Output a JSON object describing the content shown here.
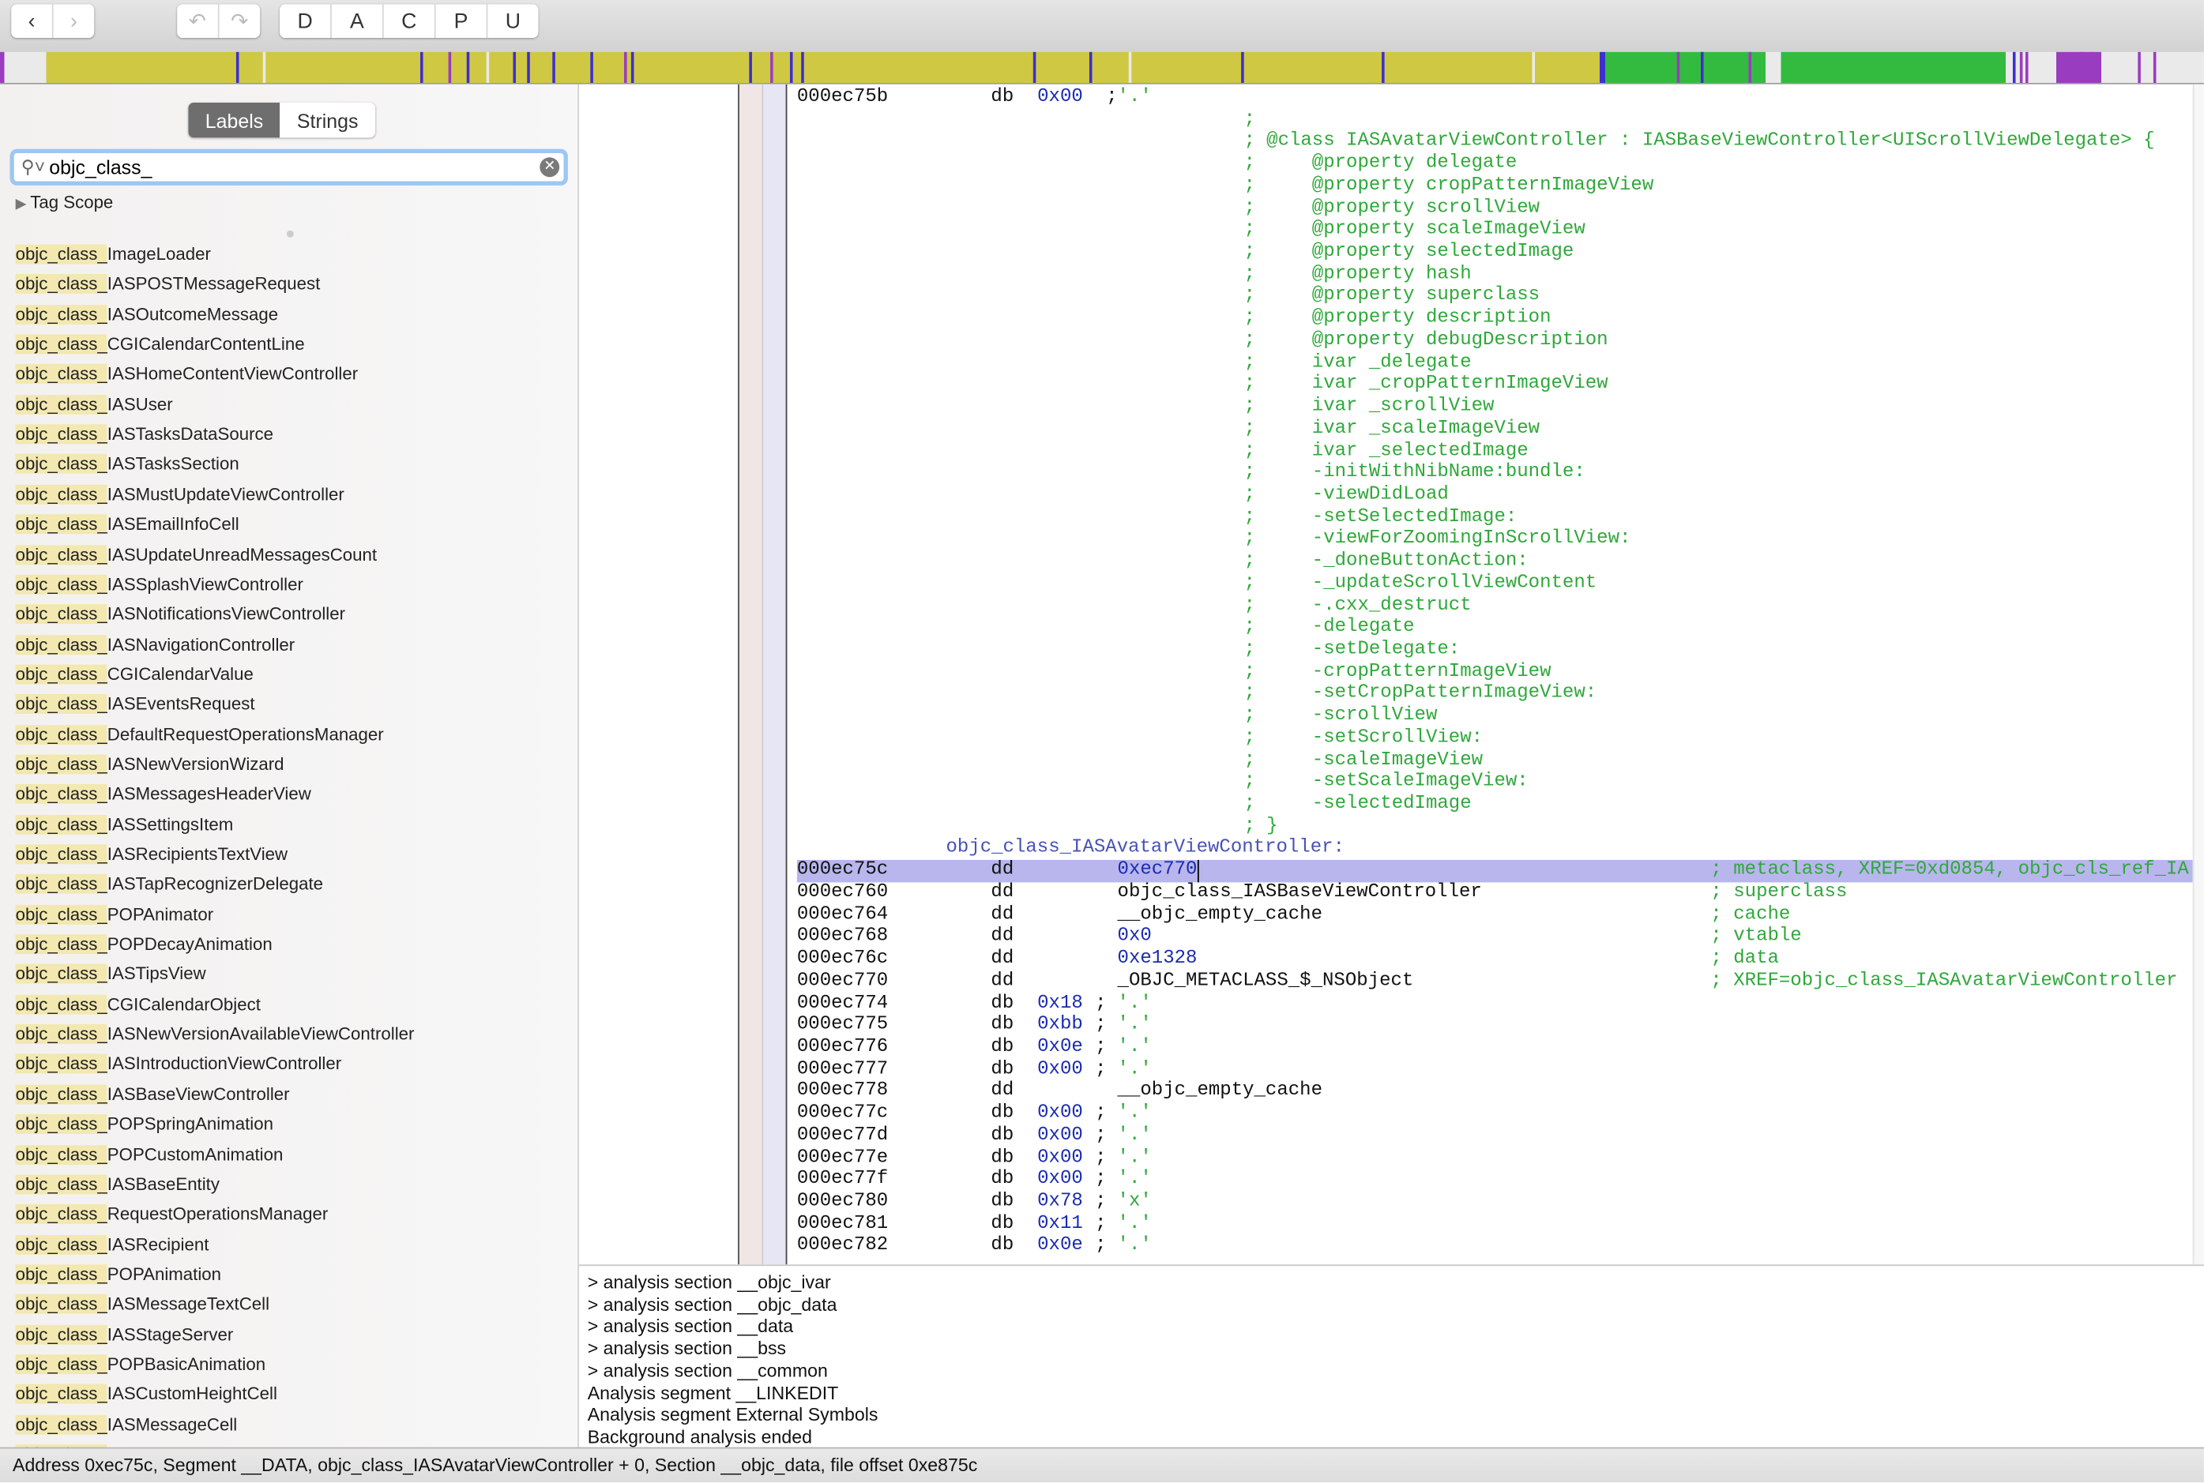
{
  "toolbar": {
    "nav": [
      {
        "icon": "chevron-left-icon",
        "label": "‹"
      },
      {
        "icon": "chevron-right-icon",
        "label": "›"
      }
    ],
    "history": [
      {
        "icon": "undo-icon",
        "label": "↶"
      },
      {
        "icon": "redo-icon",
        "label": "↷"
      }
    ],
    "modes": [
      "D",
      "A",
      "C",
      "P",
      "U"
    ]
  },
  "colorbar": {
    "colors": {
      "code": "#cfc842",
      "data": "#33bb3f",
      "external": "#9a3cc0",
      "marker": "#3d2fd0",
      "unexplored": "#eaeaea"
    }
  },
  "sidebar": {
    "tabs": [
      {
        "label": "Labels",
        "selected": true
      },
      {
        "label": "Strings",
        "selected": false
      }
    ],
    "search": {
      "value": "objc_class_",
      "icon": "search-icon"
    },
    "tag_scope": "Tag Scope",
    "match_prefix": "objc_class_",
    "items": [
      "ImageLoader",
      "IASPOSTMessageRequest",
      "IASOutcomeMessage",
      "CGICalendarContentLine",
      "IASHomeContentViewController",
      "IASUser",
      "IASTasksDataSource",
      "IASTasksSection",
      "IASMustUpdateViewController",
      "IASEmailInfoCell",
      "IASUpdateUnreadMessagesCount",
      "IASSplashViewController",
      "IASNotificationsViewController",
      "IASNavigationController",
      "CGICalendarValue",
      "IASEventsRequest",
      "DefaultRequestOperationsManager",
      "IASNewVersionWizard",
      "IASMessagesHeaderView",
      "IASSettingsItem",
      "IASRecipientsTextView",
      "IASTapRecognizerDelegate",
      "POPAnimator",
      "POPDecayAnimation",
      "IASTipsView",
      "CGICalendarObject",
      "IASNewVersionAvailableViewController",
      "IASIntroductionViewController",
      "IASBaseViewController",
      "POPSpringAnimation",
      "POPCustomAnimation",
      "IASBaseEntity",
      "RequestOperationsManager",
      "IASRecipient",
      "POPAnimation",
      "IASMessageTextCell",
      "IASStageServer",
      "POPBasicAnimation",
      "IASCustomHeightCell",
      "IASMessageCell"
    ]
  },
  "disassembly": {
    "first_row": {
      "addr": "000ec75b",
      "mn": "db",
      "val": "0x00",
      "chr": "'.'"
    },
    "comment_block": [
      "",
      "@class IASAvatarViewController : IASBaseViewController<UIScrollViewDelegate> {",
      "    @property delegate",
      "    @property cropPatternImageView",
      "    @property scrollView",
      "    @property scaleImageView",
      "    @property selectedImage",
      "    @property hash",
      "    @property superclass",
      "    @property description",
      "    @property debugDescription",
      "    ivar _delegate",
      "    ivar _cropPatternImageView",
      "    ivar _scrollView",
      "    ivar _scaleImageView",
      "    ivar _selectedImage",
      "    -initWithNibName:bundle:",
      "    -viewDidLoad",
      "    -setSelectedImage:",
      "    -viewForZoomingInScrollView:",
      "    -_doneButtonAction:",
      "    -_updateScrollViewContent",
      "    -.cxx_destruct",
      "    -delegate",
      "    -setDelegate:",
      "    -cropPatternImageView",
      "    -setCropPatternImageView:",
      "    -scrollView",
      "    -setScrollView:",
      "    -scaleImageView",
      "    -setScaleImageView:",
      "    -selectedImage",
      "}"
    ],
    "label": "objc_class_IASAvatarViewController:",
    "rows": [
      {
        "addr": "000ec75c",
        "mn": "dd",
        "arg": "0xec770",
        "kind": "num",
        "comment": "; metaclass, XREF=0xd0854, objc_cls_ref_IA",
        "selected": true
      },
      {
        "addr": "000ec760",
        "mn": "dd",
        "arg": "objc_class_IASBaseViewController",
        "kind": "sym",
        "comment": "; superclass"
      },
      {
        "addr": "000ec764",
        "mn": "dd",
        "arg": "__objc_empty_cache",
        "kind": "sym",
        "comment": "; cache"
      },
      {
        "addr": "000ec768",
        "mn": "dd",
        "arg": "0x0",
        "kind": "num",
        "comment": "; vtable"
      },
      {
        "addr": "000ec76c",
        "mn": "dd",
        "arg": "0xe1328",
        "kind": "num",
        "comment": "; data"
      },
      {
        "addr": "000ec770",
        "mn": "dd",
        "arg": "_OBJC_METACLASS_$_NSObject",
        "kind": "sym",
        "comment": "; XREF=objc_class_IASAvatarViewController"
      },
      {
        "addr": "000ec774",
        "mn": "db",
        "val": "0x18",
        "chr": "'.'"
      },
      {
        "addr": "000ec775",
        "mn": "db",
        "val": "0xbb",
        "chr": "'.'"
      },
      {
        "addr": "000ec776",
        "mn": "db",
        "val": "0x0e",
        "chr": "'.'"
      },
      {
        "addr": "000ec777",
        "mn": "db",
        "val": "0x00",
        "chr": "'.'"
      },
      {
        "addr": "000ec778",
        "mn": "dd",
        "arg": "__objc_empty_cache",
        "kind": "sym",
        "comment": ""
      },
      {
        "addr": "000ec77c",
        "mn": "db",
        "val": "0x00",
        "chr": "'.'"
      },
      {
        "addr": "000ec77d",
        "mn": "db",
        "val": "0x00",
        "chr": "'.'"
      },
      {
        "addr": "000ec77e",
        "mn": "db",
        "val": "0x00",
        "chr": "'.'"
      },
      {
        "addr": "000ec77f",
        "mn": "db",
        "val": "0x00",
        "chr": "'.'"
      },
      {
        "addr": "000ec780",
        "mn": "db",
        "val": "0x78",
        "chr": "'x'"
      },
      {
        "addr": "000ec781",
        "mn": "db",
        "val": "0x11",
        "chr": "'.'"
      },
      {
        "addr": "000ec782",
        "mn": "db",
        "val": "0x0e",
        "chr": "'.'"
      }
    ]
  },
  "log": [
    "> analysis section __objc_ivar",
    "> analysis section __objc_data",
    "> analysis section __data",
    "> analysis section __bss",
    "> analysis section __common",
    "Analysis segment __LINKEDIT",
    "Analysis segment External Symbols",
    "Background analysis ended"
  ],
  "status": "Address 0xec75c, Segment __DATA, objc_class_IASAvatarViewController + 0, Section __objc_data, file offset 0xe875c"
}
